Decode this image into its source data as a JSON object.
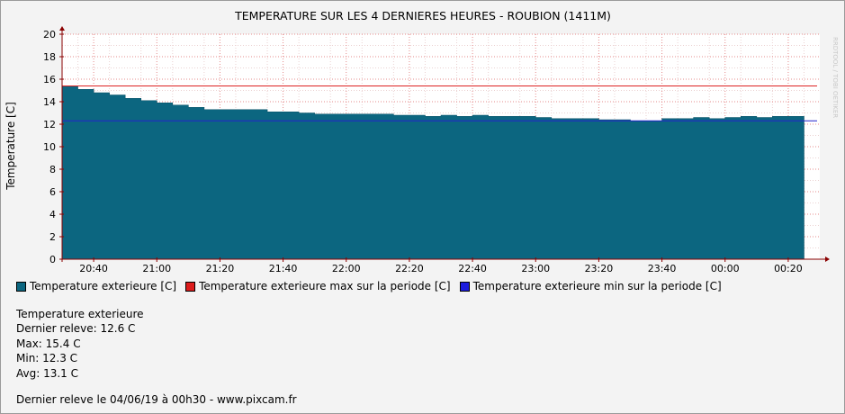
{
  "chart_data": {
    "type": "area",
    "title": "TEMPERATURE SUR LES 4 DERNIERES HEURES - ROUBION (1411M)",
    "ylabel": "Temperature [C]",
    "xlabel": "",
    "ylim": [
      0,
      20
    ],
    "y_ticks": [
      "0",
      "2",
      "4",
      "6",
      "8",
      "10",
      "12",
      "14",
      "16",
      "18",
      "20"
    ],
    "x_ticks": [
      "20:40",
      "21:00",
      "21:20",
      "21:40",
      "22:00",
      "22:20",
      "22:40",
      "23:00",
      "23:20",
      "23:40",
      "00:00",
      "00:20"
    ],
    "x_start": "20:30",
    "x_end": "00:30",
    "grid": true,
    "series": [
      {
        "name": "Temperature exterieure [C]",
        "color": "#0c6680",
        "x": [
          "20:30",
          "20:35",
          "20:40",
          "20:45",
          "20:50",
          "20:55",
          "21:00",
          "21:05",
          "21:10",
          "21:15",
          "21:20",
          "21:25",
          "21:30",
          "21:35",
          "21:40",
          "21:45",
          "21:50",
          "21:55",
          "22:00",
          "22:05",
          "22:10",
          "22:15",
          "22:20",
          "22:25",
          "22:30",
          "22:35",
          "22:40",
          "22:45",
          "22:50",
          "22:55",
          "23:00",
          "23:05",
          "23:10",
          "23:15",
          "23:20",
          "23:25",
          "23:30",
          "23:35",
          "23:40",
          "23:45",
          "23:50",
          "23:55",
          "00:00",
          "00:05",
          "00:10",
          "00:15",
          "00:20"
        ],
        "values": [
          15.4,
          15.1,
          14.8,
          14.6,
          14.3,
          14.1,
          13.9,
          13.7,
          13.5,
          13.3,
          13.3,
          13.3,
          13.3,
          13.1,
          13.1,
          13.0,
          12.9,
          12.9,
          12.9,
          12.9,
          12.9,
          12.8,
          12.8,
          12.7,
          12.8,
          12.7,
          12.8,
          12.7,
          12.7,
          12.7,
          12.6,
          12.5,
          12.5,
          12.5,
          12.4,
          12.4,
          12.3,
          12.3,
          12.5,
          12.5,
          12.6,
          12.5,
          12.6,
          12.7,
          12.6,
          12.7,
          12.7
        ]
      },
      {
        "name": "Temperature exterieure max sur la periode [C]",
        "color": "#dd2222",
        "value": 15.4
      },
      {
        "name": "Temperature exterieure min sur la periode [C]",
        "color": "#2222cc",
        "value": 12.3
      }
    ]
  },
  "legend": [
    {
      "label": "Temperature exterieure [C]",
      "color": "#0c6680"
    },
    {
      "label": "Temperature exterieure max sur la periode [C]",
      "color": "#dd1c1c"
    },
    {
      "label": "Temperature exterieure min sur la periode [C]",
      "color": "#1c1cdd"
    }
  ],
  "stats": {
    "heading": "Temperature exterieure",
    "last": "Dernier releve: 12.6 C",
    "max": "Max: 15.4 C",
    "min": "Min: 12.3 C",
    "avg": "Avg: 13.1 C"
  },
  "footer": "Dernier releve le 04/06/19 à 00h30 - www.pixcam.fr",
  "watermark": "RRDTOOL / TOBI OETIKER",
  "colors": {
    "area": "#0c6680",
    "grid_minor": "#e6c8c8",
    "grid_major": "#e48a8a",
    "axis": "#7a0000",
    "background": "#f3f3f3",
    "plot": "#ffffff"
  }
}
